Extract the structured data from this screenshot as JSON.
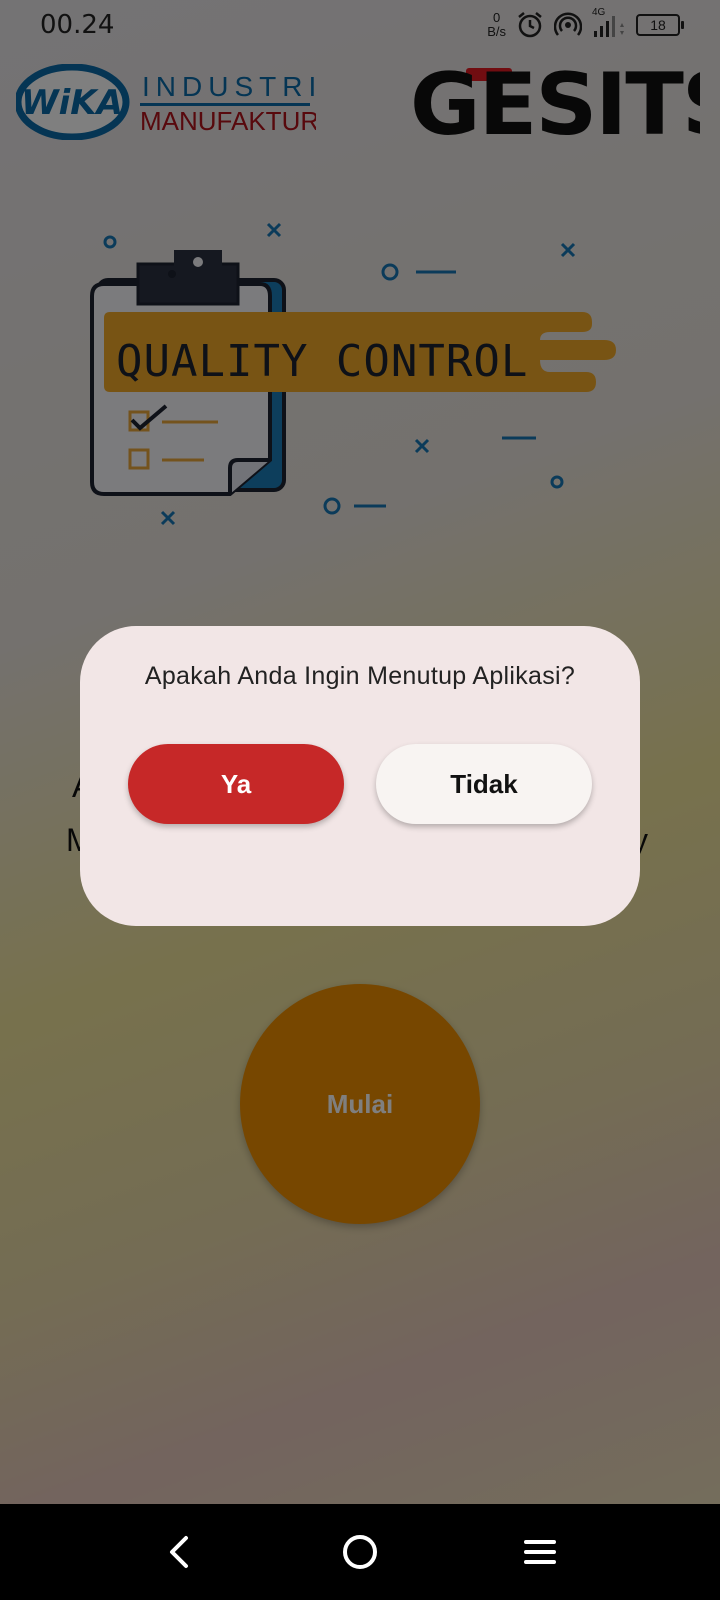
{
  "status_bar": {
    "time": "00.24",
    "net_speed_value": "0",
    "net_speed_unit": "B/s",
    "network_type": "4G",
    "battery_level": "18",
    "icons": [
      "alarm-icon",
      "hotspot-icon",
      "signal-icon",
      "battery-icon"
    ]
  },
  "header": {
    "left_logo": {
      "mark": "WiKA",
      "line1": "INDUSTRI",
      "line2": "MANUFAKTUR"
    },
    "right_logo": {
      "text": "GESITS"
    }
  },
  "illustration": {
    "banner_text": "QUALITY CONTROL"
  },
  "main": {
    "start_button_label": "Mulai"
  },
  "dialog": {
    "title": "Apakah Anda Ingin Menutup Aplikasi?",
    "yes_label": "Ya",
    "no_label": "Tidak"
  },
  "navigation": {
    "back": "back-icon",
    "home": "home-icon",
    "menu": "menu-icon"
  },
  "colors": {
    "accent_red": "#c62828",
    "start_orange": "#ef8e00",
    "dialog_bg": "#f2e6e6",
    "wika_blue": "#0a6aa8",
    "manufaktur_red": "#b0121b"
  }
}
